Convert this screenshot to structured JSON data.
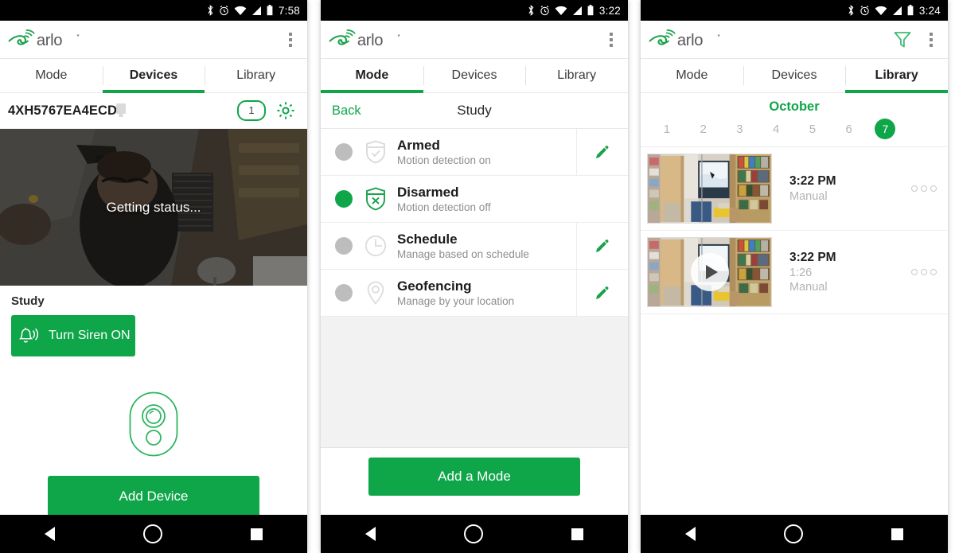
{
  "brand": {
    "name": "arlo",
    "accent": "#0FA64A",
    "logo_icon": "arlo-bird-wifi-logo"
  },
  "statusbar": {
    "icons": [
      "bluetooth-icon",
      "alarm-icon",
      "wifi-icon",
      "signal-icon",
      "battery-icon"
    ],
    "time_1": "7:58",
    "time_2": "3:22",
    "time_3": "3:24"
  },
  "tabs": {
    "mode": "Mode",
    "devices": "Devices",
    "library": "Library"
  },
  "navbar": {
    "back": "nav-back-icon",
    "home": "nav-home-icon",
    "recent": "nav-recents-icon"
  },
  "phone1": {
    "appbar": {
      "overflow": "overflow-menu-icon"
    },
    "device": {
      "name": "4XH5767EA4ECD",
      "battery_icon": "battery-icon",
      "count_badge": "1",
      "settings_icon": "gear-icon"
    },
    "camera": {
      "status_text": "Getting status..."
    },
    "section_label": "Study",
    "siren_button": {
      "label": "Turn Siren ON",
      "icon": "siren-bell-icon"
    },
    "add_device": {
      "label": "Add Device",
      "icon": "camera-outline-icon"
    }
  },
  "phone2": {
    "subbar": {
      "back": "Back",
      "title": "Study"
    },
    "modes": [
      {
        "title": "Armed",
        "subtitle": "Motion detection on",
        "selected": false,
        "icon": "shield-check-icon",
        "edit_icon": "pencil-icon",
        "editable": true
      },
      {
        "title": "Disarmed",
        "subtitle": "Motion detection off",
        "selected": true,
        "icon": "shield-x-icon",
        "edit_icon": "",
        "editable": false
      },
      {
        "title": "Schedule",
        "subtitle": "Manage based on schedule",
        "selected": false,
        "icon": "clock-icon",
        "edit_icon": "pencil-icon",
        "editable": true
      },
      {
        "title": "Geofencing",
        "subtitle": "Manage by your location",
        "selected": false,
        "icon": "map-pin-icon",
        "edit_icon": "pencil-icon",
        "editable": true
      }
    ],
    "add_mode_button": {
      "label": "Add a Mode"
    }
  },
  "phone3": {
    "appbar": {
      "filter_icon": "filter-funnel-icon",
      "overflow": "overflow-menu-icon"
    },
    "calendar": {
      "month": "October",
      "days": [
        "1",
        "2",
        "3",
        "4",
        "5",
        "6",
        "7"
      ],
      "selected_day": "7"
    },
    "clips": [
      {
        "time": "3:22 PM",
        "duration": "",
        "source": "Manual",
        "has_play": false,
        "more_icon": "more-dots-icon",
        "thumb": "room-thumbnail"
      },
      {
        "time": "3:22 PM",
        "duration": "1:26",
        "source": "Manual",
        "has_play": true,
        "more_icon": "more-dots-icon",
        "thumb": "room-thumbnail"
      }
    ]
  }
}
